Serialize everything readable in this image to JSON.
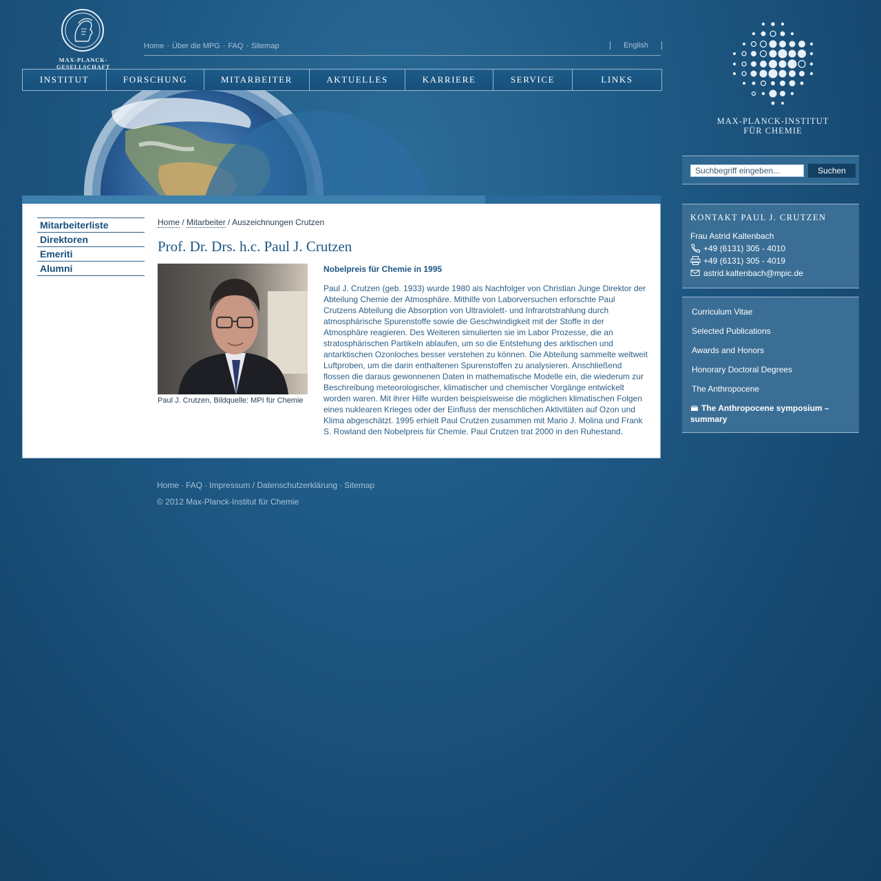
{
  "header": {
    "mpg_seal_text": "MAX-PLANCK-GESELLSCHAFT",
    "top_links": [
      "Home",
      "Über die MPG",
      "FAQ",
      "Sitemap"
    ],
    "language": "English"
  },
  "nav": {
    "items": [
      "INSTITUT",
      "FORSCHUNG",
      "MITARBEITER",
      "AKTUELLES",
      "KARRIERE",
      "SERVICE",
      "LINKS"
    ]
  },
  "institute": {
    "name_line1": "MAX-PLANCK-INSTITUT",
    "name_line2": "FÜR CHEMIE"
  },
  "search": {
    "placeholder": "Suchbegriff eingeben...",
    "button": "Suchen"
  },
  "contact": {
    "title": "KONTAKT PAUL J. CRUTZEN",
    "name": "Frau Astrid Kaltenbach",
    "phone": "+49 (6131) 305 - 4010",
    "fax": "+49 (6131) 305 - 4019",
    "email": "astrid.kaltenbach@mpic.de"
  },
  "side_links": {
    "items": [
      "Curriculum Vitae",
      "Selected Publications",
      "Awards and Honors",
      "Honorary Doctoral Degrees",
      "The Anthropocene"
    ],
    "featured": "The Anthropocene symposium – summary"
  },
  "subnav": {
    "items": [
      "Mitarbeiterliste",
      "Direktoren",
      "Emeriti",
      "Alumni"
    ]
  },
  "breadcrumb": {
    "home": "Home",
    "sep": " / ",
    "section": "Mitarbeiter",
    "current": "Auszeichnungen Crutzen"
  },
  "article": {
    "title": "Prof. Dr. Drs. h.c. Paul J. Crutzen",
    "caption": "Paul J. Crutzen, Bildquelle: MPI für Chemie",
    "subhead": "Nobelpreis für Chemie in 1995",
    "body": "Paul J. Crutzen (geb. 1933) wurde 1980 als Nachfolger von Christian Junge Direktor der Abteilung Chemie der Atmosphäre. Mithilfe von Laborversuchen erforschte Paul Crutzens Abteilung die Absorption von Ultraviolett- und Infrarotstrahlung durch atmosphärische Spurenstoffe sowie die Geschwindigkeit mit der Stoffe in der Atmosphäre reagieren. Des Weiteren simulierten sie im Labor Prozesse, die an stratosphärischen Partikeln ablaufen, um so die Entstehung des arktischen und antarktischen Ozonloches besser verstehen zu können. Die Abteilung sammelte weltweit Luftproben, um die darin enthaltenen Spurenstoffen zu analysieren. Anschließend flossen die daraus gewonnenen Daten in mathematische Modelle ein, die wiederum zur Beschreibung meteorologischer, klimatischer und chemischer Vorgänge entwickelt worden waren. Mit ihrer Hilfe wurden beispielsweise die möglichen klimatischen Folgen eines nuklearen Krieges oder der Einfluss der menschlichen Aktivitäten auf Ozon und Klima abgeschätzt. 1995 erhielt Paul Crutzen zusammen mit Mario J. Molina und Frank S. Rowland den Nobelpreis für Chemie. Paul Crutzen trat 2000 in den Ruhestand."
  },
  "footer": {
    "links": [
      "Home",
      "FAQ",
      "Impressum / Datenschutzerklärung",
      "Sitemap"
    ],
    "copyright": "© 2012 Max-Planck-Institut für Chemie"
  }
}
